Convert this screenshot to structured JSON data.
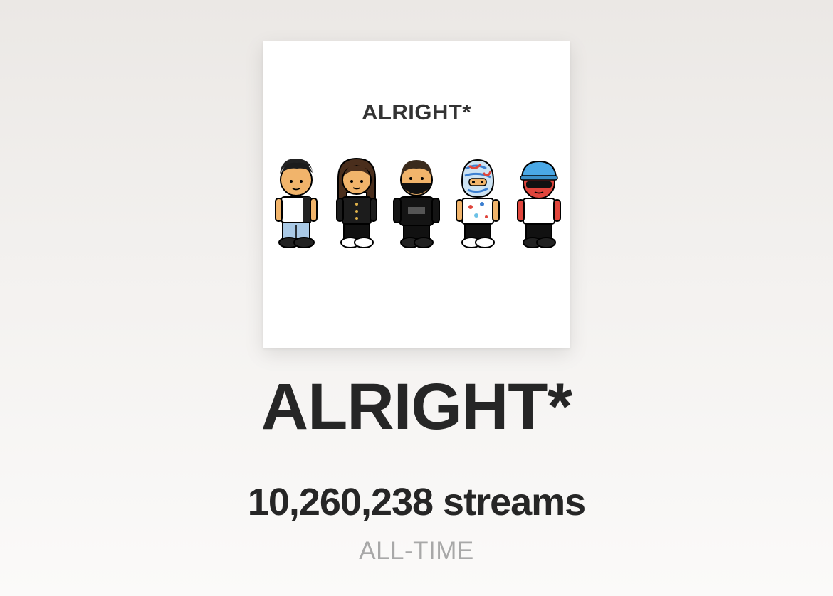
{
  "cover": {
    "title": "ALRIGHT*",
    "figures": [
      {
        "icon": "figure-white-tee-icon"
      },
      {
        "icon": "figure-long-hair-icon"
      },
      {
        "icon": "figure-masked-hoodie-icon"
      },
      {
        "icon": "figure-painted-mask-icon"
      },
      {
        "icon": "figure-red-cap-icon"
      }
    ]
  },
  "track": {
    "title": "ALRIGHT*",
    "streams": "10,260,238 streams",
    "period": "ALL-TIME"
  },
  "colors": {
    "title": "#262626",
    "period": "#a8a8a8",
    "cover_background": "#ffffff"
  }
}
